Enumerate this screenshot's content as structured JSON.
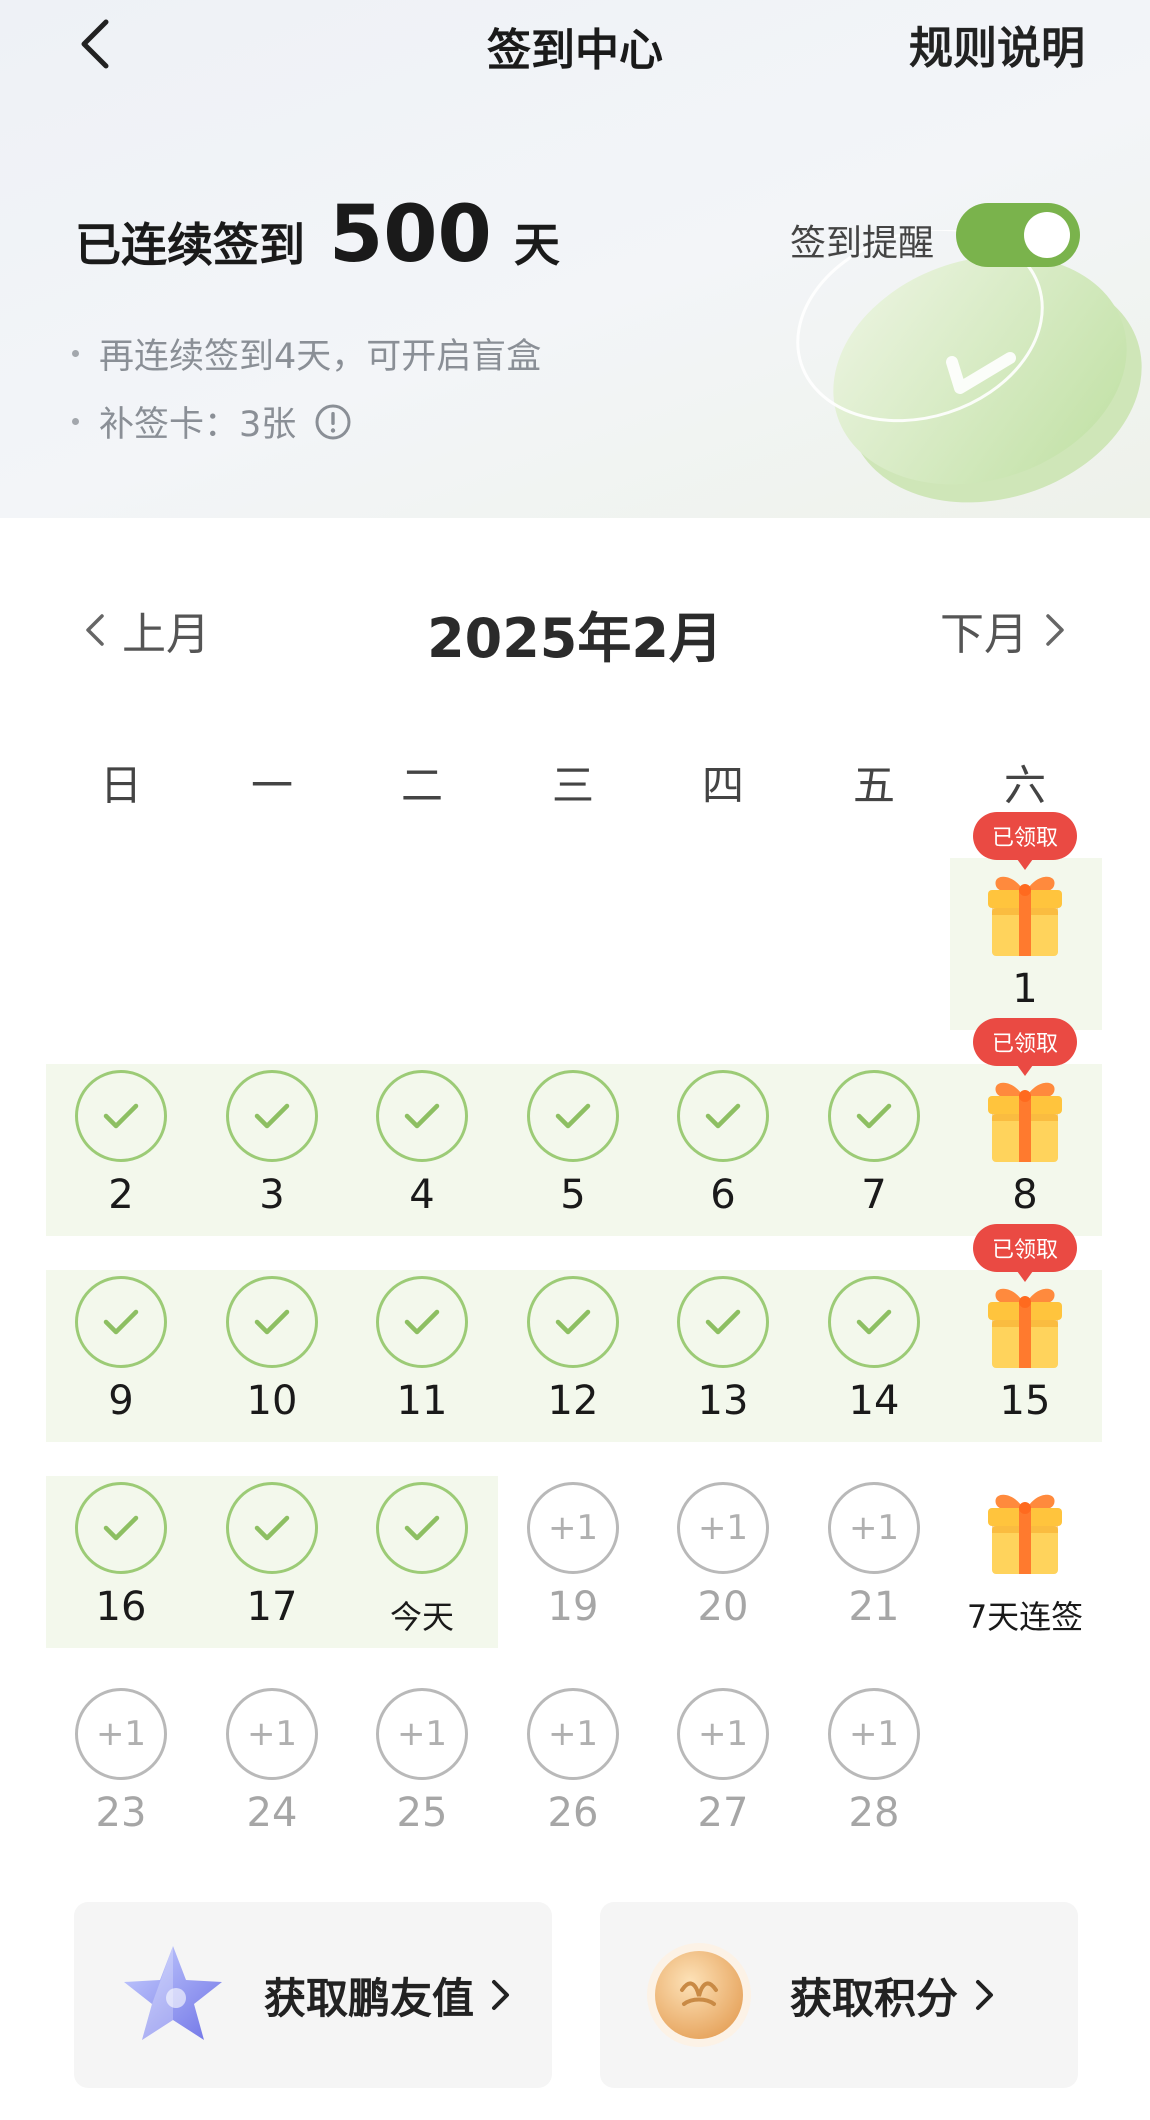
{
  "header": {
    "title": "签到中心",
    "rules_label": "规则说明"
  },
  "summary": {
    "streak_label": "已连续签到",
    "streak_days": "500",
    "streak_unit": "天",
    "reminder_label": "签到提醒",
    "reminder_on": true,
    "tip_1": "再连续签到4天，可开启盲盒",
    "tip_2": "补签卡：3张"
  },
  "calendar": {
    "prev_label": "上月",
    "next_label": "下月",
    "month_title": "2025年2月",
    "weekdays": [
      "日",
      "一",
      "二",
      "三",
      "四",
      "五",
      "六"
    ],
    "claimed_label": "已领取",
    "today_label": "今天",
    "plus_label": "+1",
    "streak_reward_label": "7天连签",
    "days": [
      "1",
      "2",
      "3",
      "4",
      "5",
      "6",
      "7",
      "8",
      "9",
      "10",
      "11",
      "12",
      "13",
      "14",
      "15",
      "16",
      "17",
      "19",
      "20",
      "21",
      "23",
      "24",
      "25",
      "26",
      "27",
      "28"
    ]
  },
  "actions": {
    "friend_value": "获取鹏友值",
    "points": "获取积分"
  },
  "colors": {
    "accent_green": "#7ab34c",
    "check_green": "#9ccb76",
    "badge_red": "#ea4a43"
  }
}
